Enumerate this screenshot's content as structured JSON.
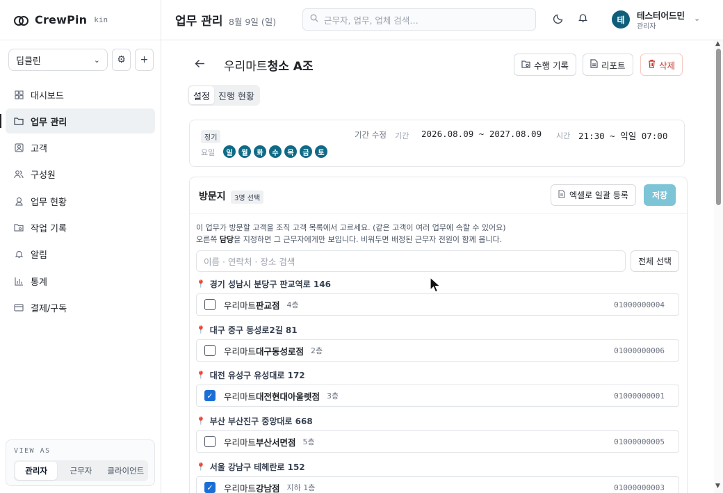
{
  "brand": {
    "name": "CrewPin",
    "sub": "kin"
  },
  "org": {
    "selected": "딥클린",
    "settings_icon": "gear-icon",
    "add_icon": "plus-icon"
  },
  "nav": [
    {
      "label": "대시보드",
      "icon": "dashboard-icon",
      "active": false
    },
    {
      "label": "업무 관리",
      "icon": "folder-icon",
      "active": true
    },
    {
      "label": "고객",
      "icon": "customer-icon",
      "active": false
    },
    {
      "label": "구성원",
      "icon": "members-icon",
      "active": false
    },
    {
      "label": "업무 현황",
      "icon": "status-icon",
      "active": false
    },
    {
      "label": "작업 기록",
      "icon": "record-icon",
      "active": false
    },
    {
      "label": "알림",
      "icon": "bell-icon",
      "active": false
    },
    {
      "label": "통계",
      "icon": "chart-icon",
      "active": false
    },
    {
      "label": "결제/구독",
      "icon": "card-icon",
      "active": false
    }
  ],
  "viewas": {
    "label": "VIEW AS",
    "tabs": [
      "관리자",
      "근무자",
      "클라이언트"
    ],
    "active": "관리자"
  },
  "topbar": {
    "title": "업무 관리",
    "date": "8월 9일 (일)",
    "search_placeholder": "근무자, 업무, 업체 검색…",
    "user": {
      "avatar": "테",
      "name": "테스터어드민",
      "role": "관리자"
    }
  },
  "job": {
    "title_prefix": "우리마트",
    "title_main": "청소 A조",
    "buttons": {
      "history": "수행 기록",
      "report": "리포트",
      "delete": "삭제"
    },
    "tabs": [
      "설정",
      "진행 현황"
    ],
    "active_tab": "설정"
  },
  "info": {
    "badge": "정기",
    "period_edit": "기간 수정",
    "period_label": "기간",
    "period_value": "2026.08.09 ~ 2027.08.09",
    "time_label": "시간",
    "time_value": "21:30 ~ 익일 07:00",
    "days_label": "요일",
    "days": [
      "일",
      "월",
      "화",
      "수",
      "목",
      "금",
      "토"
    ]
  },
  "visits": {
    "title": "방문지",
    "selected_badge": "3명 선택",
    "excel_button": "엑셀로 일괄 등록",
    "save_button": "저장",
    "help1": "이 업무가 방문할 고객을 조직 고객 목록에서 고르세요. (같은 고객이 여러 업무에 속할 수 있어요)",
    "help2_pre": "오른쪽 ",
    "help2_bold": "담당",
    "help2_post": "을 지정하면 그 근무자에게만 보입니다. 비워두면 배정된 근무자 전원이 함께 봅니다.",
    "search_placeholder": "이름 · 연락처 · 장소 검색",
    "select_all": "전체 선택",
    "groups": [
      {
        "address": "경기 성남시 분당구 판교역로 146",
        "item": {
          "prefix": "우리마트",
          "name": "판교점",
          "floor": "4층",
          "phone": "01000000004",
          "checked": false
        }
      },
      {
        "address": "대구 중구 동성로2길 81",
        "item": {
          "prefix": "우리마트",
          "name": "대구동성로점",
          "floor": "2층",
          "phone": "01000000006",
          "checked": false
        }
      },
      {
        "address": "대전 유성구 유성대로 172",
        "item": {
          "prefix": "우리마트",
          "name": "대전현대아울렛점",
          "floor": "3층",
          "phone": "01000000001",
          "checked": true
        }
      },
      {
        "address": "부산 부산진구 중앙대로 668",
        "item": {
          "prefix": "우리마트",
          "name": "부산서면점",
          "floor": "5층",
          "phone": "01000000005",
          "checked": false
        }
      },
      {
        "address": "서울 강남구 테헤란로 152",
        "item": {
          "prefix": "우리마트",
          "name": "강남점",
          "floor": "지하 1층",
          "phone": "01000000003",
          "checked": true
        }
      }
    ]
  },
  "colors": {
    "accent": "#0f6a86",
    "save": "#7cc4d6",
    "danger": "#c0392b",
    "pin": "#e0485a",
    "checkbox": "#1a6fd6"
  }
}
